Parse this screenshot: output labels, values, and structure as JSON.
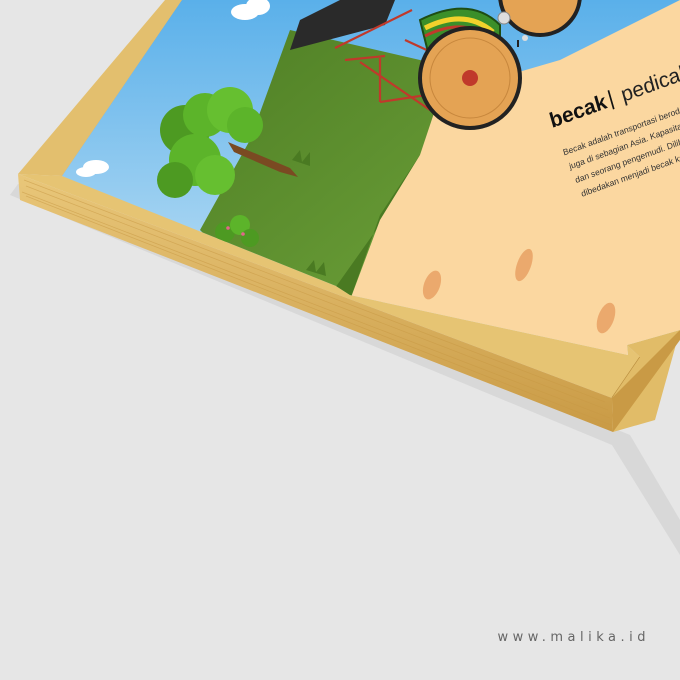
{
  "poster": {
    "title": "becak",
    "divider": "|",
    "subtitle": "pedicab",
    "description": [
      "Becak adalah transportasi beroda tiga yang umum ditemukan di Indo",
      "juga di sebagian Asia. Kapasitas normal becak adalah dua orang pen",
      "dan seorang pengemudi. Dilihat dari tenaga penggeraknya, becak d",
      "dibedakan menjadi becak kayuh dan becak bermotor (becak"
    ]
  },
  "watermark": {
    "text": "www.malika.id"
  },
  "colors": {
    "background": "#e6e6e6",
    "frame_wood": "#d9b361",
    "sky": "#8cc6ee",
    "grass": "#5e8f30",
    "sand": "#fbd7a0",
    "tree": "#5cb42a"
  }
}
